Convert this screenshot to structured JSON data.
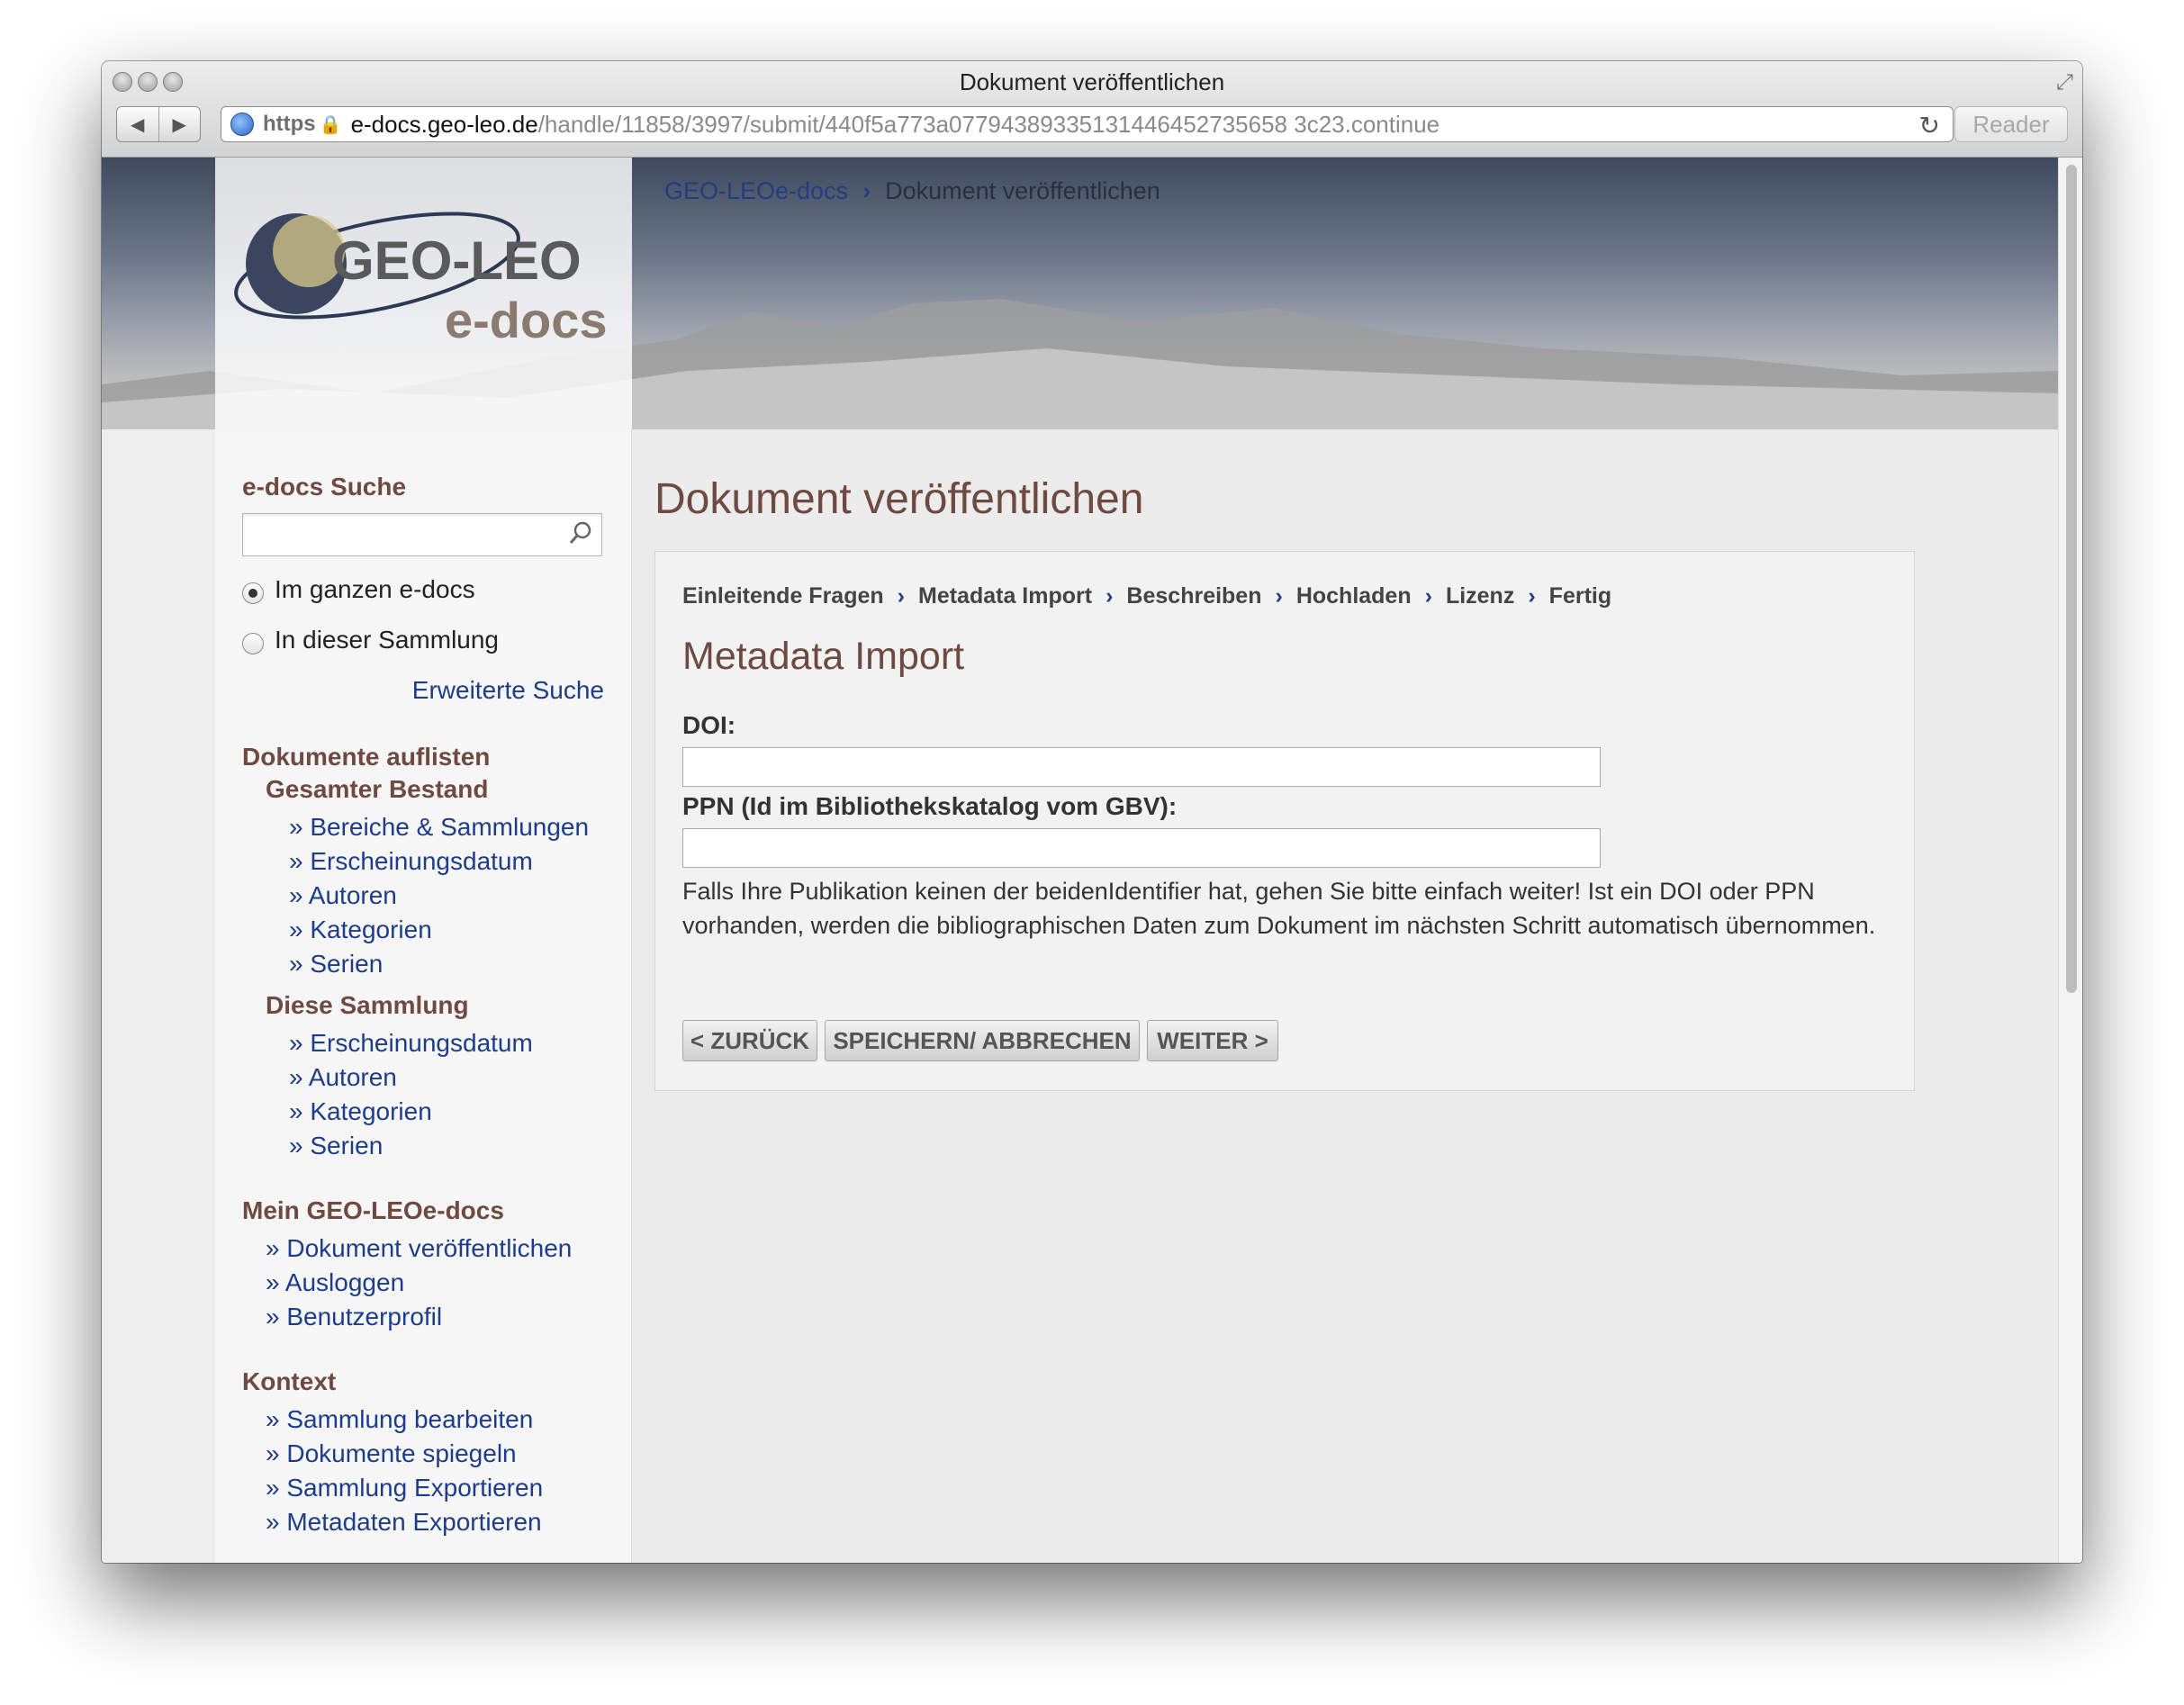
{
  "window": {
    "title": "Dokument veröffentlichen",
    "url_scheme": "https",
    "url_host": "e-docs.geo-leo.de",
    "url_path": "/handle/11858/3997/submit/440f5a773a07794389335131446452735658 3c23.continue",
    "reader_label": "Reader"
  },
  "header": {
    "breadcrumb_home": "GEO-LEOe-docs",
    "breadcrumb_sep": "›",
    "breadcrumb_current": "Dokument veröffentlichen",
    "logo_text_1": "GEO-LEO",
    "logo_text_2": "e-docs"
  },
  "sidebar": {
    "search_heading": "e-docs Suche",
    "search_placeholder": "",
    "radio_all": "Im ganzen e-docs",
    "radio_collection": "In dieser Sammlung",
    "advanced_search": "Erweiterte Suche",
    "browse_heading": "Dokumente auflisten",
    "all_heading": "Gesamter Bestand",
    "all_links": [
      "» Bereiche & Sammlungen",
      "» Erscheinungsdatum",
      "» Autoren",
      "» Kategorien",
      "» Serien"
    ],
    "this_heading": "Diese Sammlung",
    "this_links": [
      "» Erscheinungsdatum",
      "» Autoren",
      "» Kategorien",
      "» Serien"
    ],
    "my_heading": "Mein GEO-LEOe-docs",
    "my_links": [
      "» Dokument veröffentlichen",
      "» Ausloggen",
      "» Benutzerprofil"
    ],
    "context_heading": "Kontext",
    "context_links": [
      "» Sammlung bearbeiten",
      "» Dokumente spiegeln",
      "» Sammlung Exportieren",
      "» Metadaten Exportieren"
    ]
  },
  "main": {
    "page_title": "Dokument veröffentlichen",
    "steps": [
      "Einleitende Fragen",
      "Metadata Import",
      "Beschreiben",
      "Hochladen",
      "Lizenz",
      "Fertig"
    ],
    "section_title": "Metadata Import",
    "doi_label": "DOI:",
    "doi_value": "",
    "ppn_label": "PPN (Id im Bibliothekskatalog vom GBV):",
    "ppn_value": "",
    "help_text": "Falls Ihre Publikation keinen der beidenIdentifier hat, gehen Sie bitte einfach weiter! Ist ein DOI oder PPN vorhanden, werden die bibliographischen Daten zum Dokument im nächsten Schritt automatisch übernommen.",
    "btn_back": "< ZURÜCK",
    "btn_save": "SPEICHERN/ ABBRECHEN",
    "btn_next": "WEITER >"
  },
  "colors": {
    "heading_brown": "#6e4a40",
    "link_blue": "#1d3c8c"
  }
}
